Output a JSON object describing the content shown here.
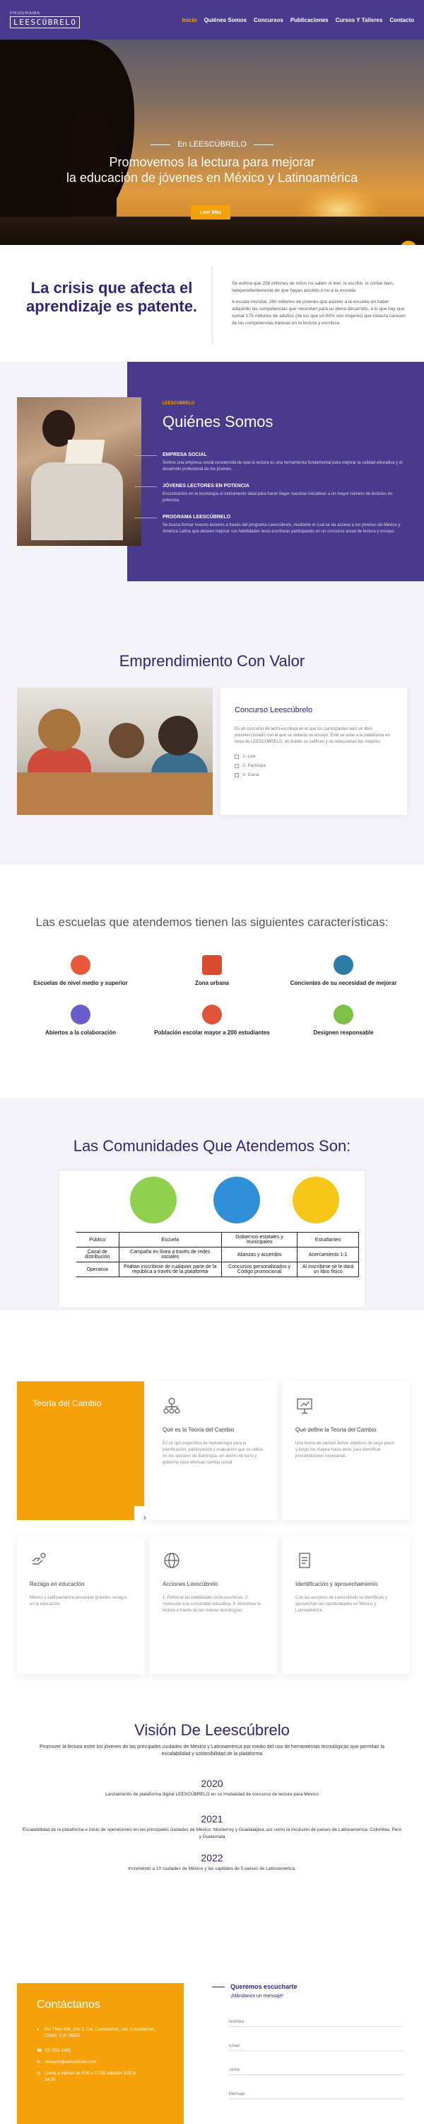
{
  "nav": {
    "logo_top": "PROGRAMA",
    "logo_main": "LEESCÚBRELO",
    "items": [
      "Inicio",
      "Quiénes Somos",
      "Concursos",
      "Publicaciones",
      "Cursos Y Talleres",
      "Contacto"
    ],
    "active_index": 0
  },
  "hero": {
    "kicker": "En LEESCÚBRELO",
    "title_line1": "Promovemos la lectura para mejorar",
    "title_line2": "la educación de jóvenes en México y Latinoamérica",
    "button": "Leer Más",
    "fab_icon": "chevron-up-icon"
  },
  "crisis": {
    "title": "La crisis que afecta el aprendizaje es patente.",
    "p1": "Se estima que 258 millones de niños no saben ni leer, ni escribir, ni contar bien, independientemente de que hayan asistido o no a la escuela.",
    "p2": "A escala mundial, 260 millones de jóvenes que asisten a la escuela sin haber adquirido las competencias que necesitan para su pleno desarrollo, a lo que hay que sumar 175 millones de adultos (de los que un 60% son mujeres) que todavía carecen de las competencias básicas en la lectura y escritura."
  },
  "quienes": {
    "kicker": "LEESCÚBRELO",
    "title": "Quiénes Somos",
    "items": [
      {
        "title": "EMPRESA SOCIAL",
        "text": "Somos una empresa social convencida de que la lectura es una herramienta fundamental para mejorar la calidad educativa y el desarrollo profesional de los jóvenes."
      },
      {
        "title": "JÓVENES LECTORES EN POTENCIA",
        "text": "Encontramos en la tecnología el instrumento ideal para hacer llegar nuestras iniciativas a un mayor número de lectores en potencia."
      },
      {
        "title": "PROGRAMA LEESCÚBRELO",
        "text": "Se busca formar nuevos lectores a través del programa Leescúbrelo, mediante el cual se da acceso a los jóvenes de México y América Latina que deseen mejorar sus habilidades lecto-escritoras participando en un concurso anual de lectura y ensayo."
      }
    ]
  },
  "emprendimiento": {
    "title": "Emprendimiento Con Valor",
    "card_title": "Concurso Leescúbrelo",
    "card_text": "Es un concurso de lecto-escritura en el que los participantes leen un libro preseleccionado con el que se redacta un ensayo. Este se sube a la plataforma en línea de LEESCÚBRELO, en donde se califican y se seleccionan los mejores.",
    "steps": [
      "1- Lee",
      "2- Participa",
      "3- Gana"
    ]
  },
  "escuelas": {
    "title": "Las escuelas que atendemos tienen las siguientes características:",
    "items": [
      {
        "label": "Escuelas de nivel medio y superior",
        "icon": "school-icon",
        "color": "#e8593a"
      },
      {
        "label": "Zona urbana",
        "icon": "bus-icon",
        "color": "#d94a2f"
      },
      {
        "label": "Concientes de su necesidad de mejorar",
        "icon": "person-icon",
        "color": "#2d7ca6"
      },
      {
        "label": "Abiertos a la colaboración",
        "icon": "network-icon",
        "color": "#6a5dc9"
      },
      {
        "label": "Población escolar mayor a 200 estudiantes",
        "icon": "students-icon",
        "color": "#e0533b"
      },
      {
        "label": "Designen responsable",
        "icon": "teacher-icon",
        "color": "#7cc24a"
      }
    ]
  },
  "comunidades": {
    "title": "Las Comunidades Que Atendemos Son:",
    "columns": [
      "Escuela",
      "Gobiernos estatales y municipales",
      "Estudiantes"
    ],
    "rows": [
      {
        "head": "Público",
        "cells": [
          "Escuela",
          "Gobiernos estatales y municipales",
          "Estudiantes"
        ]
      },
      {
        "head": "Canal de distribución",
        "cells": [
          "Campaña en línea a través de redes sociales",
          "Alianzas y acuerdos",
          "Acercamiento 1-1"
        ]
      },
      {
        "head": "Operativa",
        "cells": [
          "Podrán inscribirse de cualquier parte de la república a través de la plataforma",
          "Concursos personalizados y Código promocional",
          "Al inscribirse se le dará un libro físico"
        ]
      }
    ],
    "icon_colors": [
      "#8fd14f",
      "#2f8fd8",
      "#f5c518"
    ]
  },
  "teoria": {
    "yellow_title": "Teoría del Cambio",
    "arrow_icon": "chevron-right-icon",
    "cards": [
      {
        "title": "Qué es la Teoría del Cambio",
        "text": "Es un tipo específico de metodología para la planificación, participación y evaluación que se utiliza en los sectores de filantropía, sin ánimo de lucro y gobierno para efectuar cambio social.",
        "icon": "org-chart-icon"
      },
      {
        "title": "Qué define la Teoría del Cambio",
        "text": "Una teoría de cambio define objetivos de largo plazo y luego los mapea hacia atrás para identificar precondiciones necesarias.",
        "icon": "presentation-icon"
      },
      {
        "title": "Rezago en educación",
        "text": "México y Latinoamérica presentan grandes rezagos en la educación.",
        "icon": "hands-icon"
      },
      {
        "title": "Acciones Leescúbrelo",
        "text": "1- Reforzar las habilidades lecto-escritoras. 2- Involucrar a la comunidad educativa. 3- Incentivar la lectura a través de las nuevas tecnologías.",
        "icon": "globe-icon"
      },
      {
        "title": "Identificación y aprovechamiento",
        "text": "Con las acciones de Leescúbrelo se identifican y aprovechan las oportunidades en México y Latinoamérica.",
        "icon": "document-icon"
      }
    ]
  },
  "vision": {
    "title": "Visión De Leescúbrelo",
    "subtitle": "Promover la lectura entre los jóvenes de las principales ciudades de México y Latinoamérica por medio del uso de herramientas tecnológicas que permitan la escalabilidad y sostenibilidad de la plataforma",
    "milestones": [
      {
        "year": "2020",
        "text": "Lanzamiento de plataforma digital LEESCÚBRELO en su modalidad de concurso de lectura para México"
      },
      {
        "year": "2021",
        "text": "Escalabilidad de la plataforma e inicio de operaciones en las principales ciudades de México: Monterrey y Guadalajara, así como la incursión de países de Latinoamérica: Colombia, Perú y Guatemala"
      },
      {
        "year": "2022",
        "text": "Incremento a 10 ciudades de México y las capitales de 5 países de Latinoamérica."
      }
    ]
  },
  "contacto": {
    "title": "Contáctanos",
    "lines": [
      {
        "icon": "pin-icon",
        "text": "Río Tíber #99, piso 2, Col. Cuauhtémoc, Del. Cuauhtémoc, CDMX, C.P. 06500"
      },
      {
        "icon": "phone-icon",
        "text": "55 2011 6401"
      },
      {
        "icon": "mail-icon",
        "text": "contacto@leescubrelo.com"
      },
      {
        "icon": "clock-icon",
        "text": "Lunes a viernes de 9:00 a 17:00 sábados 9:00 a 14:00"
      }
    ],
    "form_title": "Queremos escucharte",
    "form_sub": "¡Mándanos un mensaje!",
    "fields": [
      "Nombre",
      "Email",
      "Tema",
      "Mensaje"
    ]
  }
}
